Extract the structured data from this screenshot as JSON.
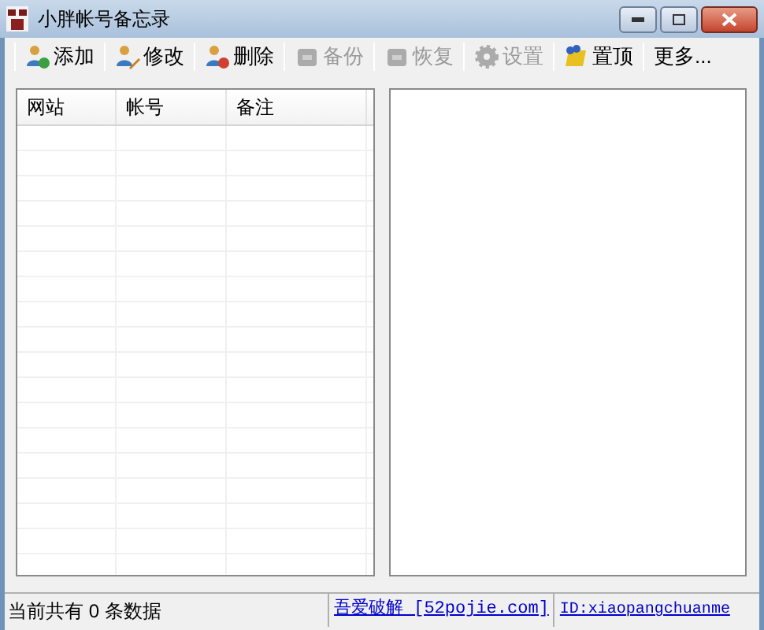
{
  "window": {
    "title": "小胖帐号备忘录"
  },
  "toolbar": [
    {
      "label": "添加",
      "kind": "add",
      "disabled": false
    },
    {
      "label": "修改",
      "kind": "edit",
      "disabled": false
    },
    {
      "label": "删除",
      "kind": "delete",
      "disabled": false
    },
    {
      "label": "备份",
      "kind": "backup",
      "disabled": true
    },
    {
      "label": "恢复",
      "kind": "restore",
      "disabled": true
    },
    {
      "label": "设置",
      "kind": "settings",
      "disabled": true
    },
    {
      "label": "置顶",
      "kind": "pin",
      "disabled": false
    },
    {
      "label": "更多...",
      "kind": "text",
      "disabled": false
    }
  ],
  "table": {
    "columns": [
      "网站",
      "帐号",
      "备注"
    ]
  },
  "status_bar": {
    "count": "当前共有 0 条数据",
    "links": [
      "吾爱破解 [52pojie.com]",
      "ID:xiaopangchuanme"
    ]
  }
}
